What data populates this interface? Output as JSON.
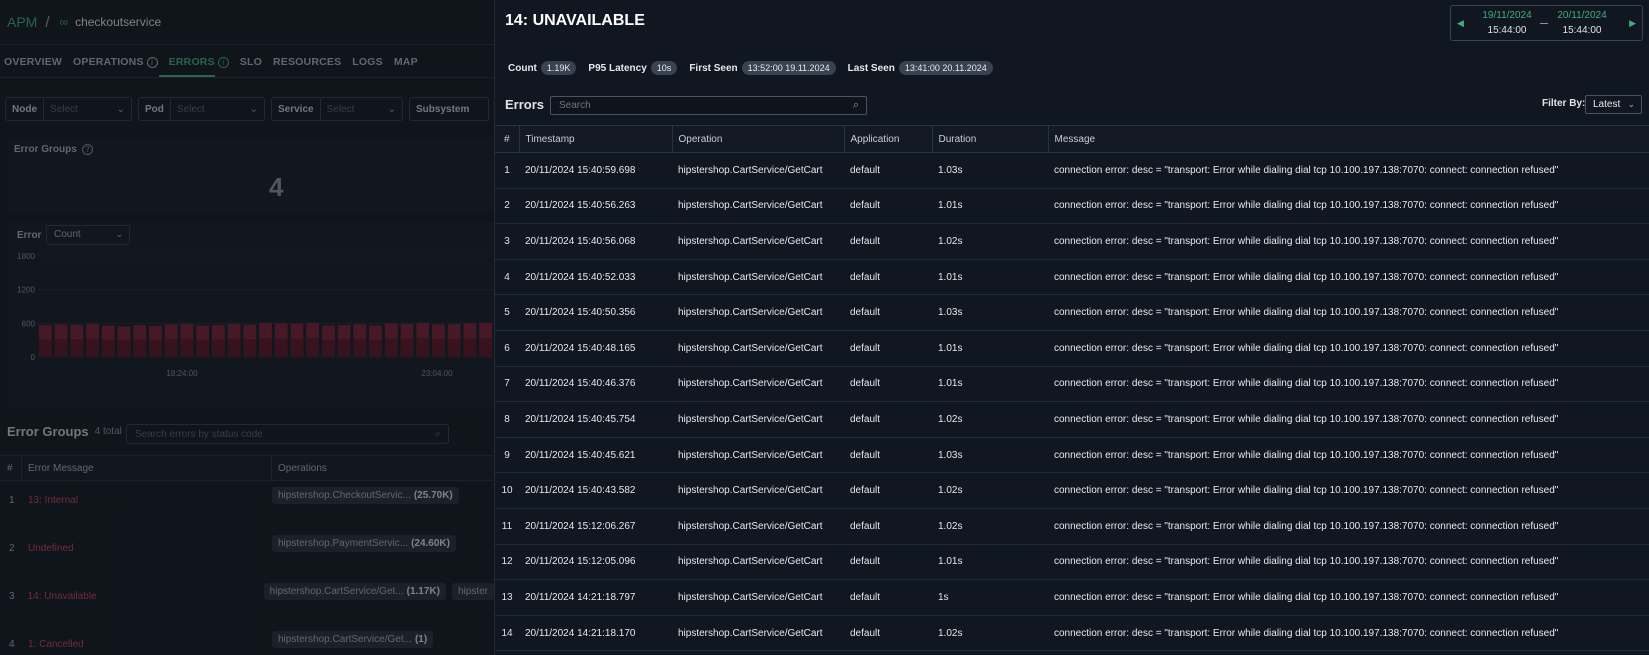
{
  "left": {
    "breadcrumb": {
      "root": "APM",
      "separator": "/",
      "service_icon": "service-icon",
      "service": "checkoutservice"
    },
    "tabs": [
      {
        "label": "OVERVIEW",
        "active": false,
        "help": false
      },
      {
        "label": "OPERATIONS",
        "active": false,
        "help": true
      },
      {
        "label": "ERRORS",
        "active": true,
        "help": true
      },
      {
        "label": "SLO",
        "active": false,
        "help": false
      },
      {
        "label": "RESOURCES",
        "active": false,
        "help": false
      },
      {
        "label": "LOGS",
        "active": false,
        "help": false
      },
      {
        "label": "MAP",
        "active": false,
        "help": false
      }
    ],
    "filters": {
      "node": {
        "label": "Node",
        "placeholder": "Select"
      },
      "pod": {
        "label": "Pod",
        "placeholder": "Select"
      },
      "service": {
        "label": "Service",
        "placeholder": "Select"
      },
      "subsystem": {
        "label": "Subsystem"
      }
    },
    "error_groups_card": {
      "title": "Error Groups",
      "value": "4"
    },
    "chart_controls": {
      "label": "Error",
      "metric": "Count"
    },
    "error_groups": {
      "title": "Error Groups",
      "total": "4 total",
      "search_placeholder": "Search errors by status code",
      "columns": [
        "#",
        "Error Message",
        "Operations"
      ],
      "rows": [
        {
          "num": "1",
          "message": "13: Internal",
          "ops": [
            {
              "name": "hipstershop.CheckoutServic...",
              "count": "(25.70K)"
            }
          ]
        },
        {
          "num": "2",
          "message": "Undefined",
          "ops": [
            {
              "name": "hipstershop.PaymentServic...",
              "count": "(24.60K)"
            }
          ]
        },
        {
          "num": "3",
          "message": "14: Unavailable",
          "ops": [
            {
              "name": "hipstershop.CartService/Get...",
              "count": "(1.17K)"
            },
            {
              "name": "hipster",
              "count": ""
            }
          ]
        },
        {
          "num": "4",
          "message": "1: Cancelled",
          "ops": [
            {
              "name": "hipstershop.CartService/Get...",
              "count": "(1)"
            }
          ]
        }
      ]
    }
  },
  "chart_data": {
    "type": "bar",
    "title": "",
    "xlabel": "",
    "ylabel": "",
    "ylim": [
      0,
      1800
    ],
    "yticks": [
      0,
      600,
      1200,
      1800
    ],
    "xtick_labels": [
      "18:24:00",
      "23:04:00"
    ],
    "bar_color": "#7a2438",
    "bar_color_dark": "#5c1a2b",
    "values": [
      570,
      580,
      575,
      590,
      560,
      545,
      570,
      555,
      580,
      590,
      560,
      570,
      590,
      575,
      610,
      600,
      595,
      610,
      560,
      570,
      585,
      560,
      600,
      590,
      610,
      580,
      585,
      600,
      610
    ],
    "split_fraction": 0.55
  },
  "drawer": {
    "title": "14: UNAVAILABLE",
    "date_range": {
      "from_date": "19/11/2024",
      "from_time": "15:44:00",
      "to_date": "20/11/2024",
      "to_time": "15:44:00"
    },
    "stats": {
      "count_label": "Count",
      "count_value": "1.19K",
      "p95_label": "P95 Latency",
      "p95_value": "10s",
      "first_label": "First Seen",
      "first_value": "13:52:00 19.11.2024",
      "last_label": "Last Seen",
      "last_value": "13:41:00 20.11.2024"
    },
    "errors_title": "Errors",
    "search_placeholder": "Search",
    "filter_by_label": "Filter By:",
    "filter_by_value": "Latest",
    "columns": [
      "#",
      "Timestamp",
      "Operation",
      "Application",
      "Duration",
      "Message"
    ],
    "rows": [
      [
        "1",
        "20/11/2024 15:40:59.698",
        "hipstershop.CartService/GetCart",
        "default",
        "1.03s",
        "connection error: desc = \"transport: Error while dialing dial tcp 10.100.197.138:7070: connect: connection refused\""
      ],
      [
        "2",
        "20/11/2024 15:40:56.263",
        "hipstershop.CartService/GetCart",
        "default",
        "1.01s",
        "connection error: desc = \"transport: Error while dialing dial tcp 10.100.197.138:7070: connect: connection refused\""
      ],
      [
        "3",
        "20/11/2024 15:40:56.068",
        "hipstershop.CartService/GetCart",
        "default",
        "1.02s",
        "connection error: desc = \"transport: Error while dialing dial tcp 10.100.197.138:7070: connect: connection refused\""
      ],
      [
        "4",
        "20/11/2024 15:40:52.033",
        "hipstershop.CartService/GetCart",
        "default",
        "1.01s",
        "connection error: desc = \"transport: Error while dialing dial tcp 10.100.197.138:7070: connect: connection refused\""
      ],
      [
        "5",
        "20/11/2024 15:40:50.356",
        "hipstershop.CartService/GetCart",
        "default",
        "1.03s",
        "connection error: desc = \"transport: Error while dialing dial tcp 10.100.197.138:7070: connect: connection refused\""
      ],
      [
        "6",
        "20/11/2024 15:40:48.165",
        "hipstershop.CartService/GetCart",
        "default",
        "1.01s",
        "connection error: desc = \"transport: Error while dialing dial tcp 10.100.197.138:7070: connect: connection refused\""
      ],
      [
        "7",
        "20/11/2024 15:40:46.376",
        "hipstershop.CartService/GetCart",
        "default",
        "1.01s",
        "connection error: desc = \"transport: Error while dialing dial tcp 10.100.197.138:7070: connect: connection refused\""
      ],
      [
        "8",
        "20/11/2024 15:40:45.754",
        "hipstershop.CartService/GetCart",
        "default",
        "1.02s",
        "connection error: desc = \"transport: Error while dialing dial tcp 10.100.197.138:7070: connect: connection refused\""
      ],
      [
        "9",
        "20/11/2024 15:40:45.621",
        "hipstershop.CartService/GetCart",
        "default",
        "1.03s",
        "connection error: desc = \"transport: Error while dialing dial tcp 10.100.197.138:7070: connect: connection refused\""
      ],
      [
        "10",
        "20/11/2024 15:40:43.582",
        "hipstershop.CartService/GetCart",
        "default",
        "1.02s",
        "connection error: desc = \"transport: Error while dialing dial tcp 10.100.197.138:7070: connect: connection refused\""
      ],
      [
        "11",
        "20/11/2024 15:12:06.267",
        "hipstershop.CartService/GetCart",
        "default",
        "1.02s",
        "connection error: desc = \"transport: Error while dialing dial tcp 10.100.197.138:7070: connect: connection refused\""
      ],
      [
        "12",
        "20/11/2024 15:12:05.096",
        "hipstershop.CartService/GetCart",
        "default",
        "1.01s",
        "connection error: desc = \"transport: Error while dialing dial tcp 10.100.197.138:7070: connect: connection refused\""
      ],
      [
        "13",
        "20/11/2024 14:21:18.797",
        "hipstershop.CartService/GetCart",
        "default",
        "1s",
        "connection error: desc = \"transport: Error while dialing dial tcp 10.100.197.138:7070: connect: connection refused\""
      ],
      [
        "14",
        "20/11/2024 14:21:18.170",
        "hipstershop.CartService/GetCart",
        "default",
        "1.02s",
        "connection error: desc = \"transport: Error while dialing dial tcp 10.100.197.138:7070: connect: connection refused\""
      ]
    ]
  }
}
